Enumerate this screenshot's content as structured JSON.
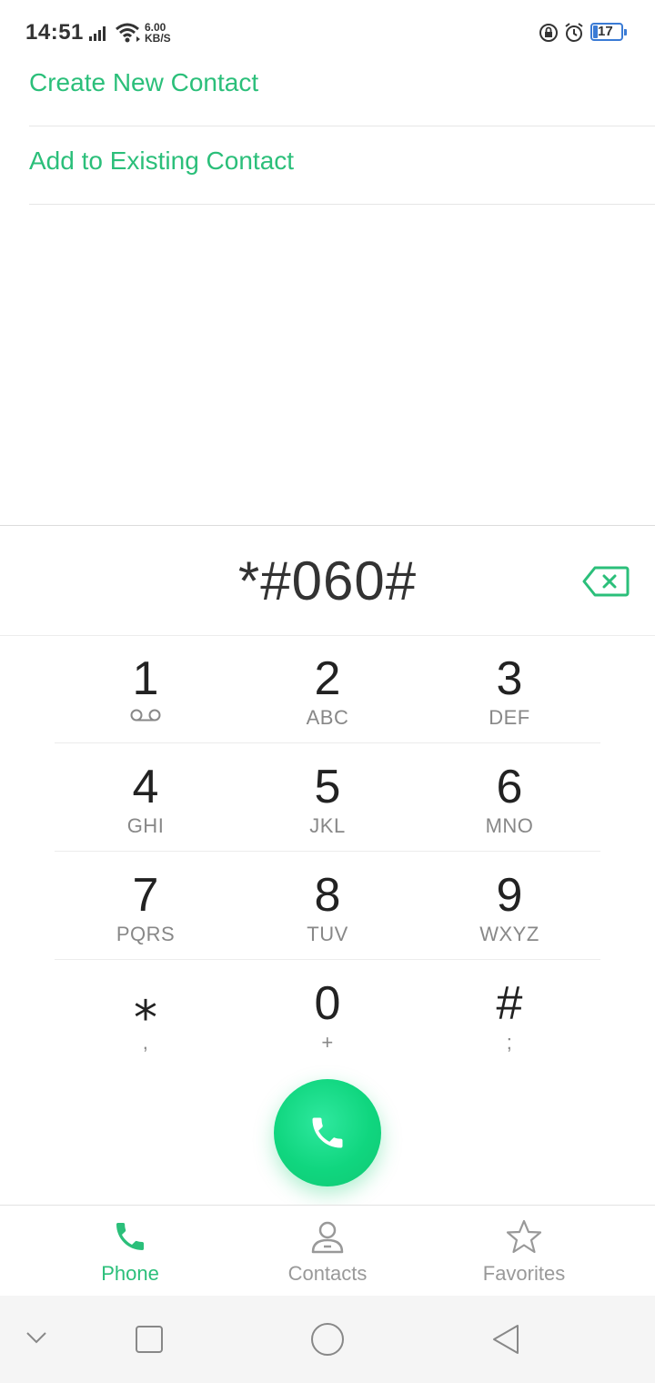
{
  "status_bar": {
    "time": "14:51",
    "speed_value": "6.00",
    "speed_unit": "KB/S",
    "battery_level": "17",
    "icons": [
      "signal-icon",
      "wifi-icon",
      "rotation-lock-icon",
      "alarm-icon",
      "battery-icon"
    ]
  },
  "menu": {
    "create_new_contact": "Create New Contact",
    "add_to_existing_contact": "Add to Existing Contact"
  },
  "dialer": {
    "number": "*#060#",
    "keys": [
      {
        "digit": "1",
        "letters": ""
      },
      {
        "digit": "2",
        "letters": "ABC"
      },
      {
        "digit": "3",
        "letters": "DEF"
      },
      {
        "digit": "4",
        "letters": "GHI"
      },
      {
        "digit": "5",
        "letters": "JKL"
      },
      {
        "digit": "6",
        "letters": "MNO"
      },
      {
        "digit": "7",
        "letters": "PQRS"
      },
      {
        "digit": "8",
        "letters": "TUV"
      },
      {
        "digit": "9",
        "letters": "WXYZ"
      },
      {
        "digit": "⁎",
        "letters": ","
      },
      {
        "digit": "0",
        "letters": "+"
      },
      {
        "digit": "#",
        "letters": ";"
      }
    ]
  },
  "tabs": [
    {
      "label": "Phone",
      "active": true
    },
    {
      "label": "Contacts",
      "active": false
    },
    {
      "label": "Favorites",
      "active": false
    }
  ],
  "colors": {
    "accent": "#2bbf7a",
    "call_button": "#10d67f",
    "inactive_tab": "#999999"
  }
}
